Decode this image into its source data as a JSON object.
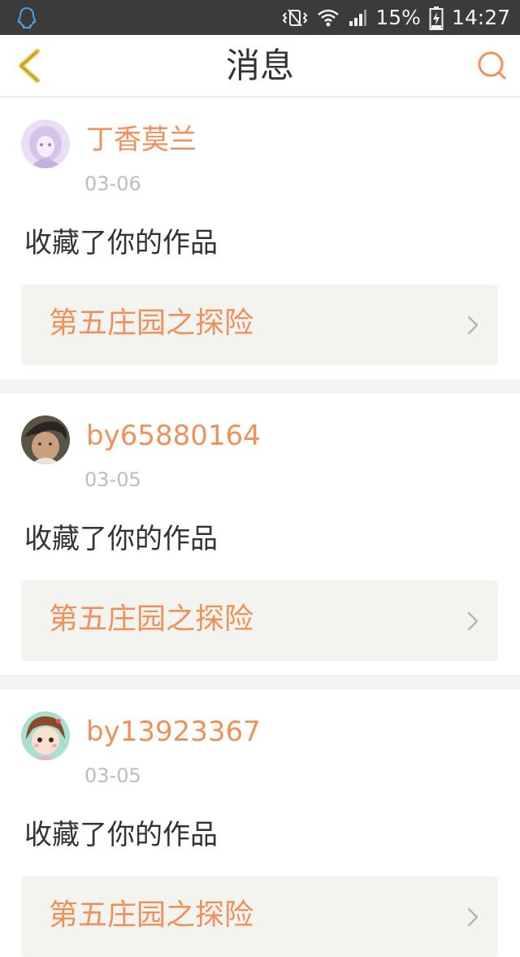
{
  "status_bar": {
    "battery_pct": "15%",
    "clock": "14:27",
    "icons": [
      "qq-icon",
      "vibrate-icon",
      "wifi-icon",
      "signal-icon",
      "battery-charging-icon"
    ]
  },
  "header": {
    "title": "消息",
    "back_icon": "chevron-left-icon",
    "search_icon": "search-icon"
  },
  "colors": {
    "accent": "#f0915a",
    "back_arrow": "#f0c33c",
    "text_dark": "#333333",
    "date_gray": "#bdbdbd",
    "work_box_bg": "#f3f3ef",
    "divider": "#f4f4f4"
  },
  "messages": [
    {
      "username": "丁香莫兰",
      "date": "03-06",
      "action": "收藏了你的作品",
      "work_title": "第五庄园之探险"
    },
    {
      "username": "by65880164",
      "date": "03-05",
      "action": "收藏了你的作品",
      "work_title": "第五庄园之探险"
    },
    {
      "username": "by13923367",
      "date": "03-05",
      "action": "收藏了你的作品",
      "work_title": "第五庄园之探险"
    }
  ]
}
